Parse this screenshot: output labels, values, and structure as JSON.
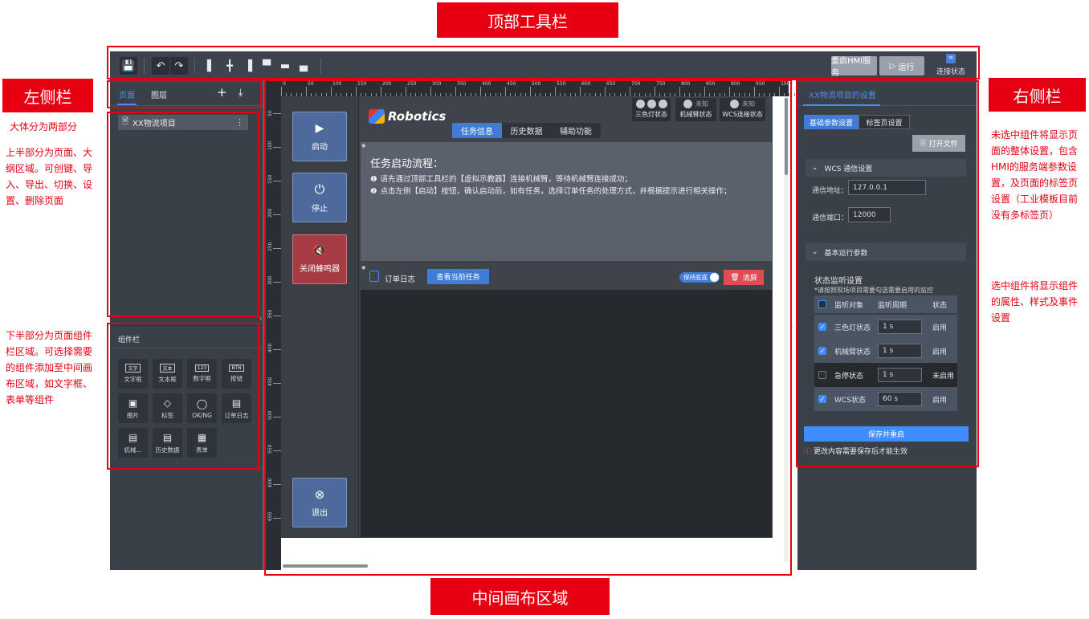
{
  "annotations": {
    "top_toolbar": "顶部工具栏",
    "left_sidebar": "左侧栏",
    "right_sidebar": "右侧栏",
    "canvas_area": "中间画布区域",
    "left_note_1": "大体分为两部分",
    "left_note_2": "上半部分为页面、大纲区域。可创键、导入、导出、切换、设置、删除页面",
    "left_note_3": "下半部分为页面组件栏区域。可选择需要的组件添加至中间画布区域，如文字框、表单等组件",
    "right_note_1": "未选中组件将显示页面的整体设置，包含HMI的服务端参数设置，及页面的标签页设置（工业模板目前没有多标签页）",
    "right_note_2": "选中组件将显示组件的属性、样式及事件设置"
  },
  "toolbar": {
    "restart_label": "重启HMI服务",
    "run_label": "运行",
    "conn_label": "连接状态"
  },
  "left": {
    "tab_pages": "页面",
    "tab_layers": "图层",
    "project_name": "XX物流项目",
    "component_header": "组件栏",
    "components": [
      {
        "label": "文字框",
        "icon": "text-label-icon"
      },
      {
        "label": "文本框",
        "icon": "textbox-icon"
      },
      {
        "label": "数字框",
        "icon": "number-box-icon"
      },
      {
        "label": "按钮",
        "icon": "button-icon"
      },
      {
        "label": "图片",
        "icon": "image-icon"
      },
      {
        "label": "标签",
        "icon": "tag-icon"
      },
      {
        "label": "OK/NG",
        "icon": "okng-icon"
      },
      {
        "label": "订单日志",
        "icon": "order-log-icon"
      },
      {
        "label": "机械...",
        "icon": "robot-arm-icon"
      },
      {
        "label": "历史数据",
        "icon": "history-data-icon"
      },
      {
        "label": "表单",
        "icon": "table-icon"
      }
    ],
    "component_glyphs": [
      "文字",
      "文本",
      "123",
      "BTN"
    ]
  },
  "ruler": {
    "top_ticks": [
      "0",
      "50",
      "100",
      "150",
      "200",
      "250",
      "300",
      "350",
      "400",
      "450",
      "500",
      "550",
      "600",
      "650",
      "700",
      "750",
      "800",
      "850",
      "900",
      "950",
      "1000"
    ],
    "left_ticks": [
      "50",
      "100",
      "150",
      "200",
      "250",
      "300",
      "350",
      "400",
      "450",
      "500",
      "550",
      "600",
      "650"
    ]
  },
  "stage": {
    "btn_start": "启动",
    "btn_stop": "停止",
    "btn_mute": "关闭蜂鸣器",
    "btn_exit": "退出",
    "logo": "Robotics",
    "tabs": [
      "任务信息",
      "历史数据",
      "辅助功能"
    ],
    "status_light": "三色灯状态",
    "status_arm": "机械臂状态",
    "status_wcs": "WCS连接状态",
    "unknown": "未知",
    "task_title": "任务启动流程：",
    "task_step1": "请先通过顶部工具栏的【虚拟示教器】连接机械臂，等待机械臂连接成功；",
    "task_step2": "点击左侧【启动】按钮，确认启动后，如有任务，选择订单任务的处理方式，并根据提示进行相关操作；",
    "order_log": "订单日志",
    "view_task": "查看当前任务",
    "keep_bottom": "保持底底",
    "clear": "清屏"
  },
  "right": {
    "header": "XX物流项目的设置",
    "tab_basic": "基础参数设置",
    "tab_tags": "标签页设置",
    "open_file": "打开文件",
    "wcs_section": "WCS 通信设置",
    "addr_label": "通信地址：",
    "addr_value": "127.0.0.1",
    "port_label": "通信端口：",
    "port_value": "12000",
    "run_section": "基本运行参数",
    "monitor_title": "状态监听设置",
    "monitor_hint": "*请按照现场项目需要勾选需要启用的监控",
    "col_target": "监听对象",
    "col_period": "监听周期",
    "col_status": "状态",
    "rows": [
      {
        "target": "三色灯状态",
        "period": "1 s",
        "status": "启用",
        "checked": true
      },
      {
        "target": "机械臂状态",
        "period": "1 s",
        "status": "启用",
        "checked": true
      },
      {
        "target": "急停状态",
        "period": "1 s",
        "status": "未启用",
        "checked": false
      },
      {
        "target": "WCS状态",
        "period": "60 s",
        "status": "启用",
        "checked": true
      }
    ],
    "save_label": "保存并重启",
    "save_hint": "更改内容需要保存后才能生效"
  }
}
